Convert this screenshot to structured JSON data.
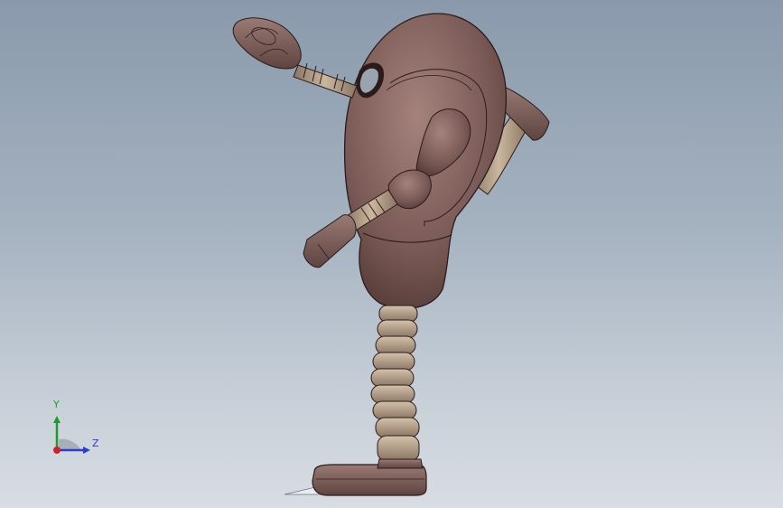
{
  "viewport": {
    "background_top": "#8a9aac",
    "background_bottom": "#d8dde3"
  },
  "model": {
    "body_color": "#7a5a56",
    "limb_color": "#b6a08a",
    "outline_color": "#2a1c1a"
  },
  "triad": {
    "y_label": "Y",
    "z_label": "Z",
    "y_color": "#1f9a2f",
    "z_color": "#2a3ed0",
    "x_color": "#d0202a"
  }
}
